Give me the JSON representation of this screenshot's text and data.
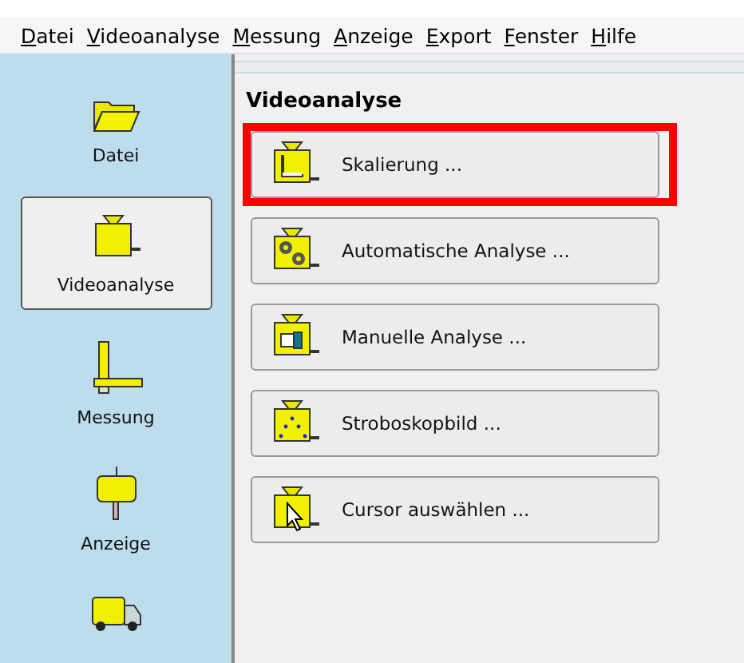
{
  "menu": [
    {
      "key": "D",
      "rest": "atei"
    },
    {
      "key": "V",
      "rest": "ideoanalyse"
    },
    {
      "key": "M",
      "rest": "essung"
    },
    {
      "key": "A",
      "rest": "nzeige"
    },
    {
      "key": "E",
      "rest": "xport"
    },
    {
      "key": "F",
      "rest": "enster"
    },
    {
      "key": "H",
      "rest": "ilfe"
    }
  ],
  "sidebar": {
    "items": [
      {
        "kind": "folder",
        "label": "Datei",
        "selected": false
      },
      {
        "kind": "camera",
        "label": "Videoanalyse",
        "selected": true
      },
      {
        "kind": "ruler",
        "label": "Messung",
        "selected": false
      },
      {
        "kind": "sign",
        "label": "Anzeige",
        "selected": false
      },
      {
        "kind": "truck",
        "selected": false
      }
    ]
  },
  "panel": {
    "title": "Videoanalyse",
    "actions": [
      {
        "kind": "scale",
        "label": "Skalierung ...",
        "highlighted": true
      },
      {
        "kind": "gears",
        "label": "Automatische Analyse ...",
        "highlighted": false
      },
      {
        "kind": "hand",
        "label": "Manuelle Analyse ...",
        "highlighted": false
      },
      {
        "kind": "strobe",
        "label": "Stroboskopbild ...",
        "highlighted": false
      },
      {
        "kind": "cursor",
        "label": "Cursor auswählen ...",
        "highlighted": false
      }
    ]
  }
}
